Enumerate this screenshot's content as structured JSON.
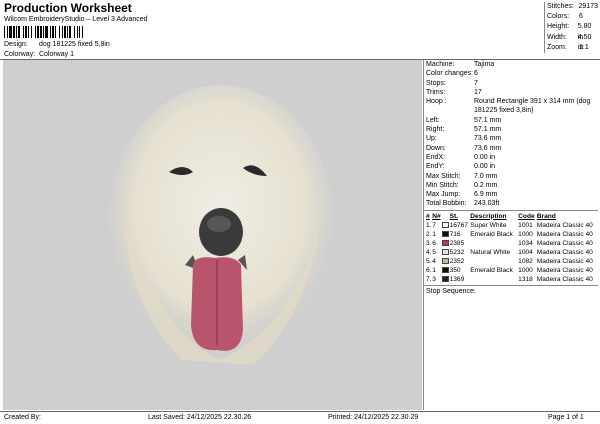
{
  "header": {
    "title": "Production Worksheet",
    "subtitle": "Wilcom EmbroideryStudio – Level 3 Advanced",
    "barcode_icon": "barcode-icon",
    "design_label": "Design:",
    "design_value": "dog 181225 fixed 5,8in",
    "colorway_label": "Colorway:",
    "colorway_value": "Colorway 1"
  },
  "stats": [
    {
      "k": "Stitches:",
      "v": "29173"
    },
    {
      "k": "Colors:",
      "v": "6"
    },
    {
      "k": "Height:",
      "v": "5.80 in"
    },
    {
      "k": "Width:",
      "v": "4.50 in"
    },
    {
      "k": "Zoom:",
      "v": "1:1"
    }
  ],
  "machine_info": [
    {
      "k": "Machine:",
      "v": "Tajima"
    },
    {
      "k": "Color changes:",
      "v": "6"
    },
    {
      "k": "Stops:",
      "v": "7"
    },
    {
      "k": "Trims:",
      "v": "17"
    },
    {
      "k": "Hoop :",
      "v": "Round Rectangle 391 x 314 mm (dog 181225 fixed 3,8in)"
    },
    {
      "k": "Left:",
      "v": "57.1 mm"
    },
    {
      "k": "Right:",
      "v": "57.1 mm"
    },
    {
      "k": "Up:",
      "v": "73.6 mm"
    },
    {
      "k": "Down:",
      "v": "73.6 mm"
    },
    {
      "k": "EndX:",
      "v": "0.00 in"
    },
    {
      "k": "EndY:",
      "v": "0.00 in"
    },
    {
      "k": "Max Stitch:",
      "v": "7.0 mm"
    },
    {
      "k": "Min Stitch:",
      "v": "0.2 mm"
    },
    {
      "k": "Max Jump:",
      "v": "6.9 mm"
    },
    {
      "k": "Total Bobbin:",
      "v": "243.03ft"
    }
  ],
  "colors_table": {
    "headers": [
      "#",
      "N#",
      "",
      "St.",
      "Description",
      "Code",
      "Brand"
    ],
    "rows": [
      {
        "num": "1.",
        "n": "7",
        "color": "#f4f4f4",
        "st": "16767",
        "desc": "Super White",
        "code": "1001",
        "brand": "Madeira Classic 40"
      },
      {
        "num": "2.",
        "n": "1",
        "color": "#111111",
        "st": "716",
        "desc": "Emerald Black",
        "code": "1000",
        "brand": "Madeira Classic 40"
      },
      {
        "num": "3.",
        "n": "6",
        "color": "#b23a5c",
        "st": "2385",
        "desc": "",
        "code": "1034",
        "brand": "Madeira Classic 40"
      },
      {
        "num": "4.",
        "n": "5",
        "color": "#ece6d4",
        "st": "5232",
        "desc": "Natural White",
        "code": "1004",
        "brand": "Madeira Classic 40"
      },
      {
        "num": "5.",
        "n": "4",
        "color": "#c8b89a",
        "st": "2352",
        "desc": "",
        "code": "1082",
        "brand": "Madeira Classic 40"
      },
      {
        "num": "6.",
        "n": "1",
        "color": "#111111",
        "st": "350",
        "desc": "Emerald Black",
        "code": "1000",
        "brand": "Madeira Classic 40"
      },
      {
        "num": "7.",
        "n": "3",
        "color": "#222222",
        "st": "1369",
        "desc": "",
        "code": "1318",
        "brand": "Madeira Classic 40"
      }
    ]
  },
  "stop_sequence_label": "Stop Sequence:",
  "footer": {
    "created_by": "Created By:",
    "last_saved": "Last Saved: 24/12/2025 22.30.26",
    "printed": "Printed: 24/12/2025 22.30.29",
    "page": "Page 1 of 1"
  }
}
